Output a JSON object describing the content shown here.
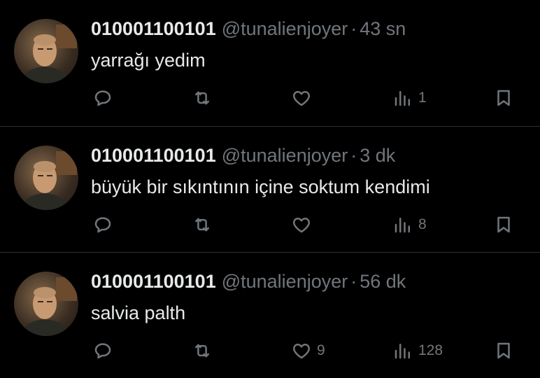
{
  "tweets": [
    {
      "author": {
        "name": "010001100101",
        "handle": "@tunalienjoyer"
      },
      "separator": "·",
      "time": "43 sn",
      "text": "yarrağı yedim",
      "reply_count": "",
      "retweet_count": "",
      "like_count": "",
      "view_count": "1"
    },
    {
      "author": {
        "name": "010001100101",
        "handle": "@tunalienjoyer"
      },
      "separator": "·",
      "time": "3 dk",
      "text": "büyük bir sıkıntının içine soktum kendimi",
      "reply_count": "",
      "retweet_count": "",
      "like_count": "",
      "view_count": "8"
    },
    {
      "author": {
        "name": "010001100101",
        "handle": "@tunalienjoyer"
      },
      "separator": "·",
      "time": "56 dk",
      "text": "salvia palth",
      "reply_count": "",
      "retweet_count": "",
      "like_count": "9",
      "view_count": "128"
    }
  ],
  "icons": [
    "reply-icon",
    "retweet-icon",
    "like-icon",
    "views-icon",
    "bookmark-icon"
  ],
  "colors": {
    "background": "#000000",
    "text": "#e7e9ea",
    "muted": "#71767b",
    "divider": "#2f3336"
  }
}
